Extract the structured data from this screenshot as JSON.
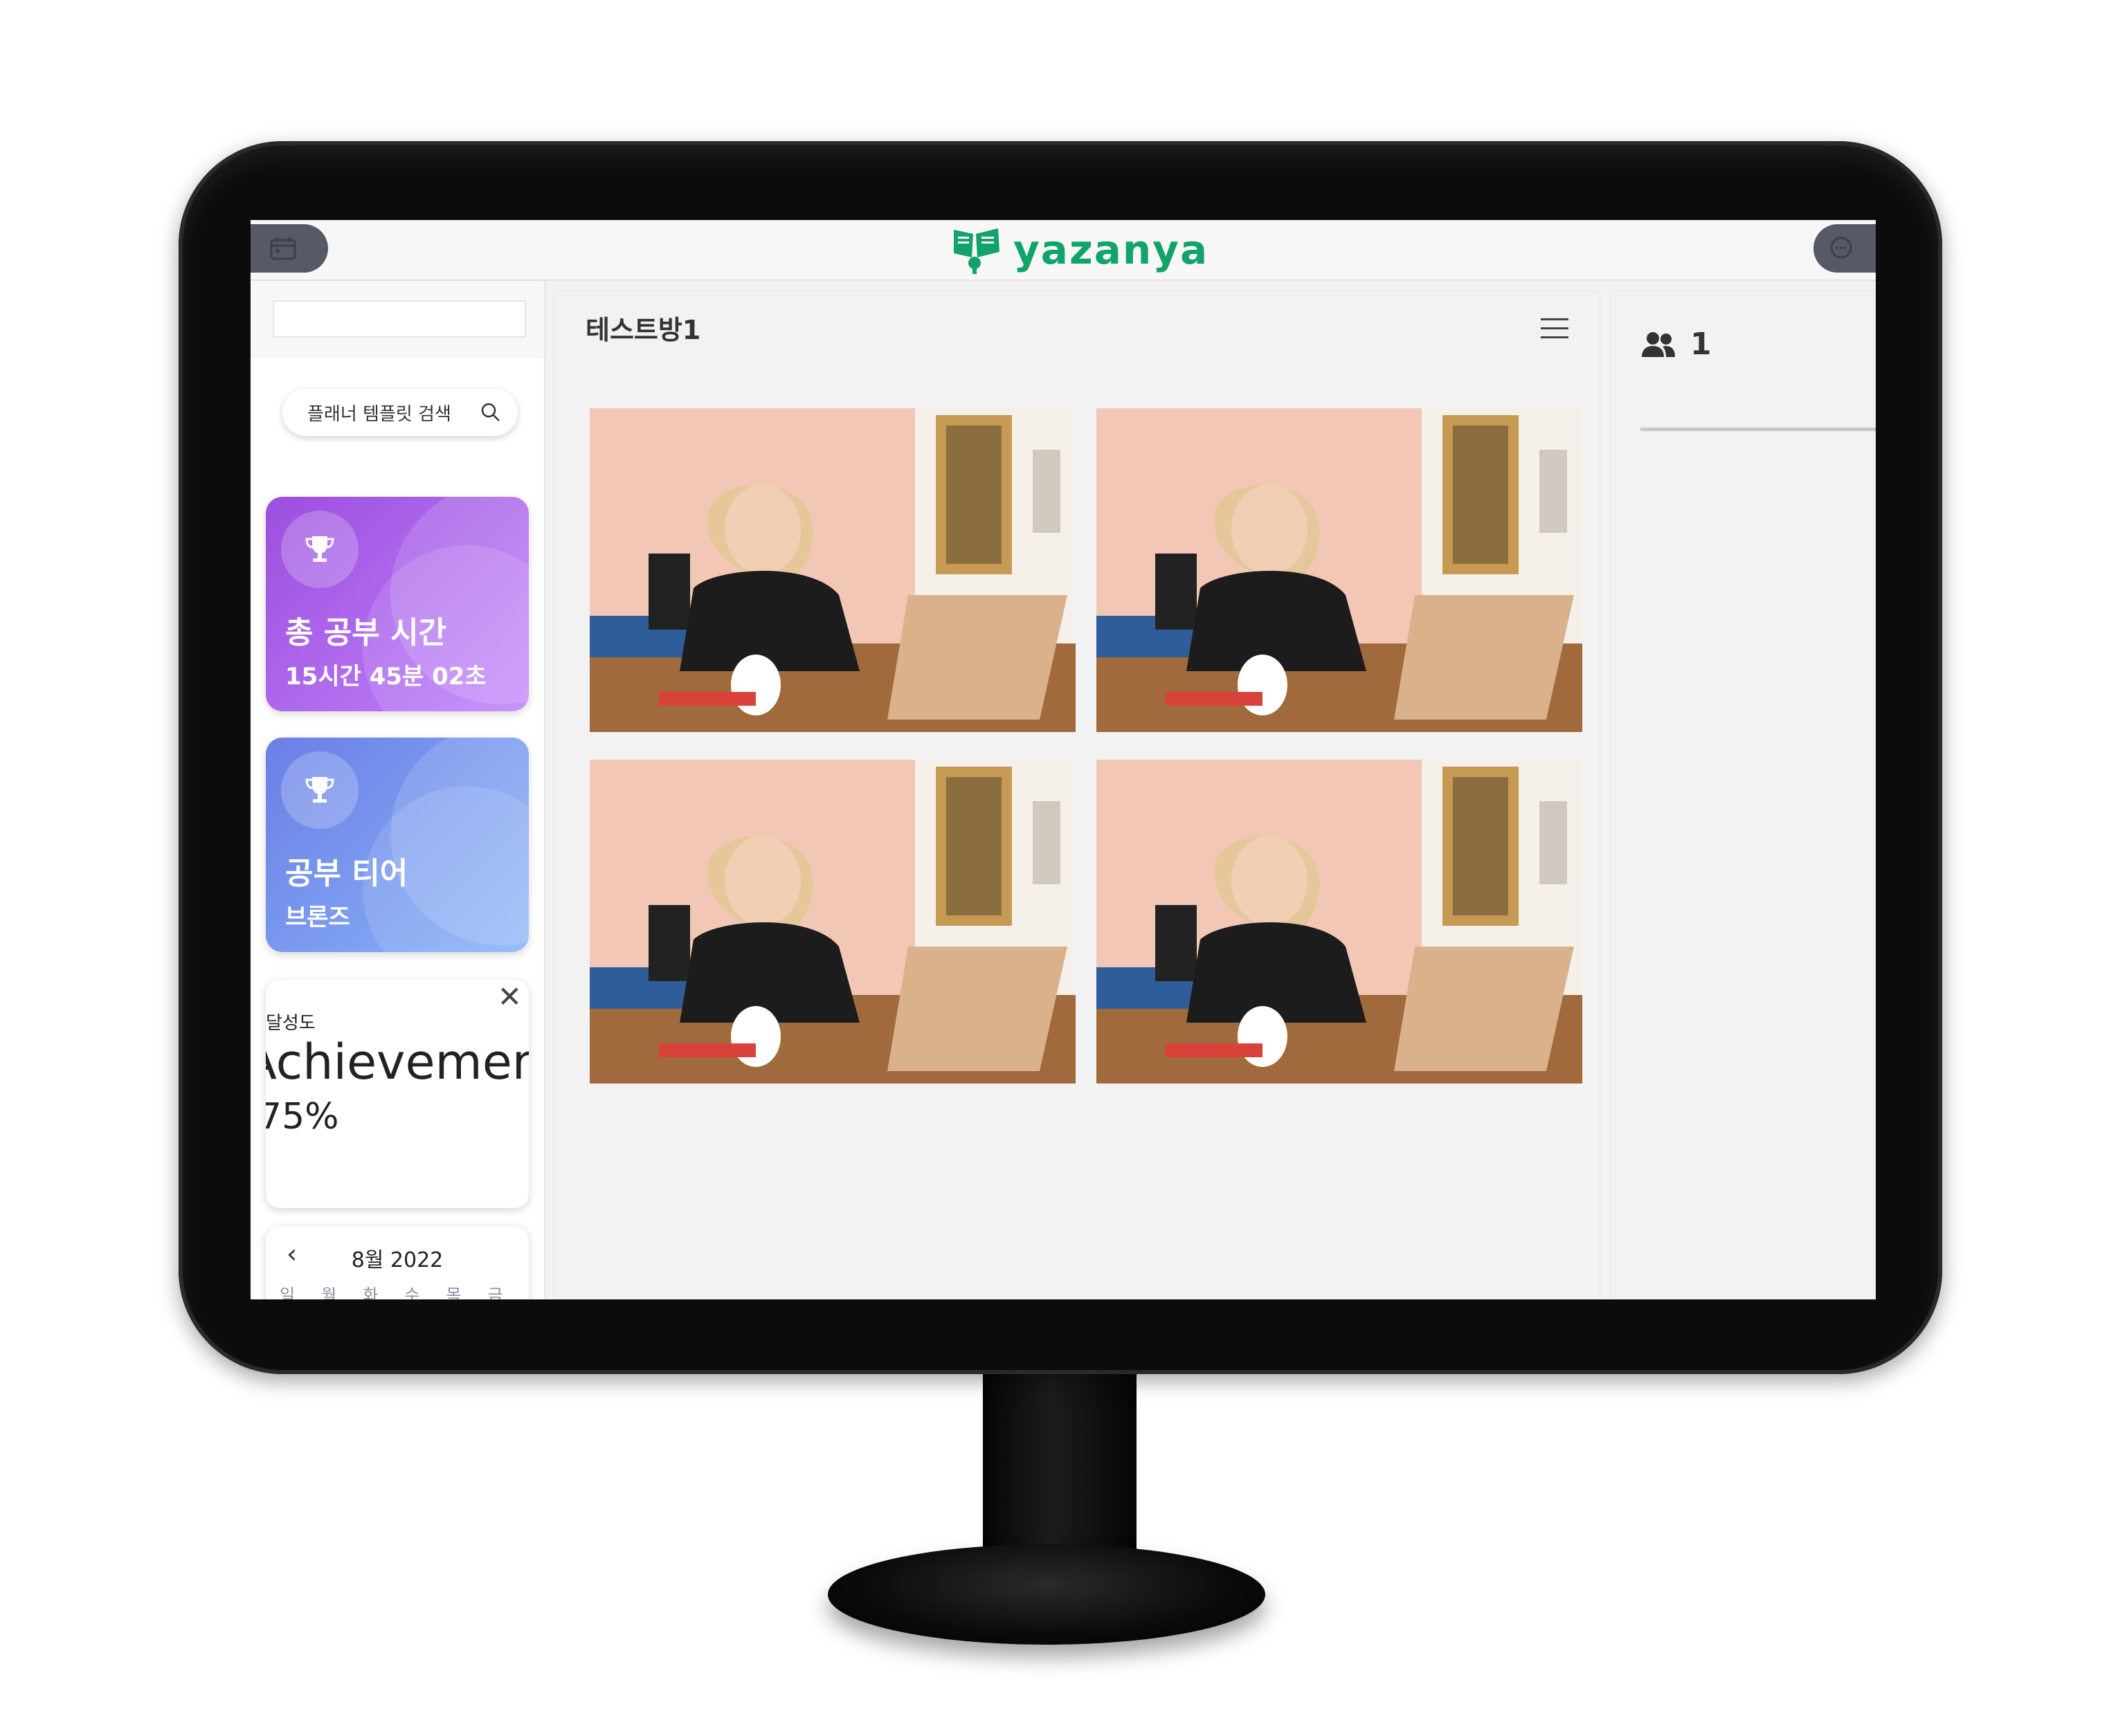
{
  "app": {
    "logo_text": "yazanya",
    "brand_color": "#12a36b"
  },
  "topbar": {
    "left_icon": "calendar-icon",
    "right_icon": "chat-icon"
  },
  "sidebar": {
    "template_search": {
      "label": "플래너 템플릿 검색",
      "icon": "search-icon"
    },
    "cards": [
      {
        "title": "총 공부 시간",
        "value": "15시간 45분 02초",
        "icon": "trophy-icon",
        "color": "#9d4edd"
      },
      {
        "title": "공부 티어",
        "value": "브론즈",
        "icon": "trophy-icon",
        "color": "#6b7fe6"
      }
    ],
    "achievement": {
      "label": "달성도",
      "title": "Achievement",
      "value": "75%"
    },
    "calendar": {
      "month": "8월 2022",
      "weekdays": [
        "일",
        "월",
        "화",
        "수",
        "목",
        "금"
      ]
    }
  },
  "main": {
    "room_title": "테스트방1",
    "video_tiles": 4
  },
  "right_panel": {
    "participant_count": "1",
    "icon": "users-icon"
  }
}
